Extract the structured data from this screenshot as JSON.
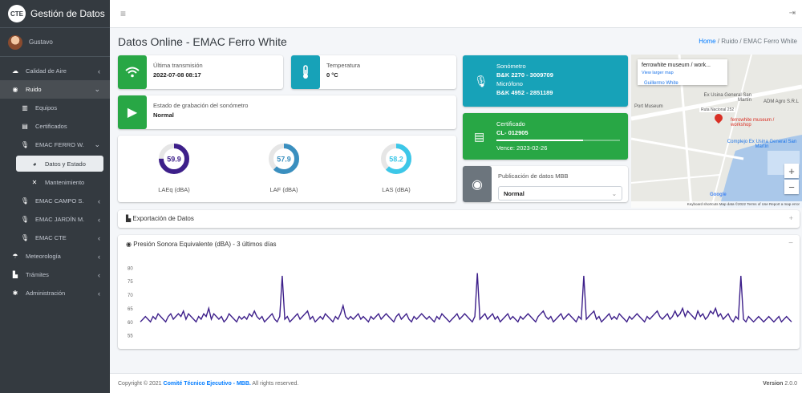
{
  "brand": {
    "logo": "CTE",
    "name": "Gestión de Datos"
  },
  "user": {
    "name": "Gustavo"
  },
  "sidebar": {
    "items": [
      {
        "label": "Calidad de Aire",
        "icon": "cloud-icon"
      },
      {
        "label": "Ruido",
        "icon": "ruido-icon"
      },
      {
        "label": "Equipos",
        "icon": "equipos-icon"
      },
      {
        "label": "Certificados",
        "icon": "file-icon"
      },
      {
        "label": "EMAC FERRO W.",
        "icon": "mic-icon"
      },
      {
        "label": "Datos y Estado",
        "icon": "tachometer-icon"
      },
      {
        "label": "Mantenimiento",
        "icon": "tools-icon"
      },
      {
        "label": "EMAC CAMPO S.",
        "icon": "mic-icon"
      },
      {
        "label": "EMAC JARDÍN M.",
        "icon": "mic-icon"
      },
      {
        "label": "EMAC CTE",
        "icon": "mic-icon"
      },
      {
        "label": "Meteorología",
        "icon": "weather-icon"
      },
      {
        "label": "Trámites",
        "icon": "folder-icon"
      },
      {
        "label": "Administración",
        "icon": "gear-icon"
      }
    ]
  },
  "header": {
    "title": "Datos Online - EMAC Ferro White",
    "breadcrumb": {
      "home": "Home",
      "sep": "/",
      "l2": "Ruido",
      "l3": "EMAC Ferro White"
    }
  },
  "transmission": {
    "label": "Última transmisión",
    "value": "2022-07-08 08:17"
  },
  "temperature": {
    "label": "Temperatura",
    "value": "0 °C"
  },
  "recording": {
    "label": "Estado de grabación del sonómetro",
    "value": "Normal"
  },
  "gauges": [
    {
      "value": "59.9",
      "label": "LAEq (dBA)",
      "fill": 0.75,
      "color": "#3d1f8a"
    },
    {
      "value": "57.9",
      "label": "LAF (dBA)",
      "fill": 0.62,
      "color": "#3a8fbf"
    },
    {
      "value": "58.2",
      "label": "LAS (dBA)",
      "fill": 0.62,
      "color": "#3cc7e8"
    }
  ],
  "sonometer": {
    "title": "Sonómetro",
    "model": "B&K 2270 - 3009709",
    "mic_title": "Micrófono",
    "mic_model": "B&K 4952 - 2851189"
  },
  "certificate": {
    "title": "Certificado",
    "number": "CL- 012905",
    "expires": "Vence: 2023-02-26",
    "progress": 0.7
  },
  "publication": {
    "label": "Publicación de datos MBB",
    "value": "Normal"
  },
  "map": {
    "place": "ferrowhite museum / work...",
    "larger": "View larger map",
    "labels": [
      "Guillermo White",
      "Ex Usina General San Martín",
      "ADM Agro S.R.L",
      "Port Museum",
      "ferrowhite museum / workshop",
      "Complejo Ex Usina General San Martín",
      "Ruta Nacional 252",
      "Google"
    ],
    "footer": "Keyboard shortcuts  Map data ©2022  Terms of Use  Report a map error"
  },
  "export": {
    "label": "Exportación de Datos"
  },
  "chart": {
    "title": "Presión Sonora Equivalente (dBA) - 3 últimos días"
  },
  "chart_data": {
    "type": "line",
    "title": "Presión Sonora Equivalente (dBA) - 3 últimos días",
    "ylim": [
      53,
      82
    ],
    "yticks": [
      80,
      75,
      70,
      65,
      60,
      55
    ],
    "color": "#3d1f8a",
    "y": [
      60,
      61,
      62,
      61,
      60,
      62,
      61,
      63,
      62,
      61,
      60,
      62,
      63,
      61,
      62,
      63,
      62,
      64,
      61,
      63,
      62,
      61,
      60,
      62,
      61,
      63,
      62,
      65,
      61,
      63,
      62,
      61,
      62,
      60,
      61,
      63,
      62,
      61,
      60,
      62,
      61,
      62,
      61,
      63,
      62,
      64,
      62,
      61,
      62,
      60,
      61,
      62,
      63,
      61,
      60,
      62,
      77,
      61,
      62,
      60,
      61,
      62,
      63,
      61,
      62,
      63,
      64,
      61,
      62,
      60,
      61,
      62,
      61,
      63,
      62,
      61,
      60,
      62,
      61,
      63,
      66,
      62,
      61,
      62,
      61,
      62,
      63,
      61,
      62,
      61,
      60,
      62,
      61,
      62,
      63,
      61,
      62,
      63,
      62,
      61,
      60,
      62,
      63,
      61,
      62,
      63,
      61,
      60,
      62,
      61,
      62,
      63,
      62,
      61,
      62,
      61,
      60,
      62,
      61,
      63,
      62,
      61,
      60,
      61,
      62,
      63,
      61,
      62,
      63,
      62,
      61,
      60,
      62,
      78,
      61,
      62,
      63,
      61,
      62,
      63,
      61,
      62,
      60,
      61,
      62,
      63,
      61,
      62,
      61,
      60,
      62,
      61,
      62,
      63,
      62,
      61,
      60,
      62,
      63,
      64,
      62,
      61,
      62,
      60,
      61,
      62,
      63,
      61,
      62,
      63,
      62,
      61,
      60,
      62,
      61,
      77,
      61,
      62,
      63,
      64,
      61,
      62,
      60,
      61,
      62,
      63,
      61,
      62,
      61,
      63,
      62,
      61,
      60,
      62,
      61,
      62,
      63,
      62,
      61,
      60,
      62,
      61,
      62,
      63,
      64,
      62,
      61,
      62,
      63,
      61,
      62,
      64,
      62,
      63,
      65,
      62,
      64,
      63,
      62,
      61,
      64,
      62,
      63,
      61,
      62,
      64,
      63,
      65,
      62,
      63,
      61,
      62,
      63,
      61,
      60,
      62,
      61,
      77,
      61,
      60,
      62,
      61,
      60,
      61,
      62,
      61,
      60,
      61,
      62,
      61,
      60,
      61,
      62,
      60,
      61,
      62,
      61,
      60
    ]
  },
  "footer": {
    "prefix": "Copyright © 2021 ",
    "org": "Comité Técnico Ejecutivo - MBB.",
    "suffix": " All rights reserved.",
    "version_label": "Version",
    "version": "2.0.0"
  }
}
